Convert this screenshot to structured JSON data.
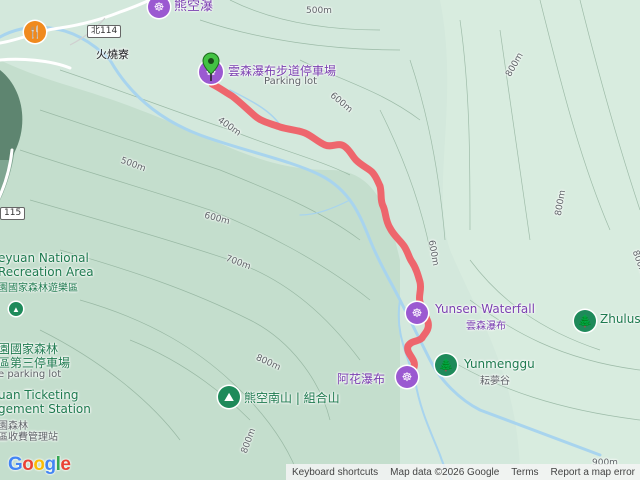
{
  "map": {
    "roads": [
      {
        "label": "北114"
      },
      {
        "label": "北114"
      },
      {
        "label": "115"
      }
    ],
    "village": "火燒寮",
    "parking": {
      "name": "雲森瀑布步道停車場",
      "sub": "Parking lot"
    },
    "waterfall": {
      "name": "Yunsen Waterfall",
      "name_zh": "雲森瀑布"
    },
    "ahua": "阿花瀑布",
    "yunmenggu": {
      "name": "Yunmenggu",
      "name_zh": "耘夢谷"
    },
    "mountain": "熊空南山 | 組合山",
    "top_poi": "熊空瀑",
    "zhulu": "Zhulus",
    "left_labels": [
      "eyuan National",
      "Recreation Area",
      "園國家森林遊樂區",
      "園國家森林",
      "區第三停車場",
      "e parking lot",
      "uan Ticketing",
      "gement Station",
      "園森林",
      "區收費管理站"
    ],
    "contours": [
      "500m",
      "800m",
      "600m",
      "400m",
      "500m",
      "600m",
      "700m",
      "800m",
      "800m",
      "800m",
      "700m",
      "600m",
      "800m",
      "600m",
      "900m"
    ],
    "colors": {
      "trail": "#ef5f66",
      "water": "#a8d4ee",
      "terrain": "#cfe6d9",
      "park": "#1e7a4f",
      "poi": "#9b59d1",
      "food": "#f08a1e"
    }
  },
  "footer": {
    "logo": "Google",
    "shortcuts": "Keyboard shortcuts",
    "mapdata": "Map data ©2026 Google",
    "terms": "Terms",
    "report": "Report a map error"
  }
}
